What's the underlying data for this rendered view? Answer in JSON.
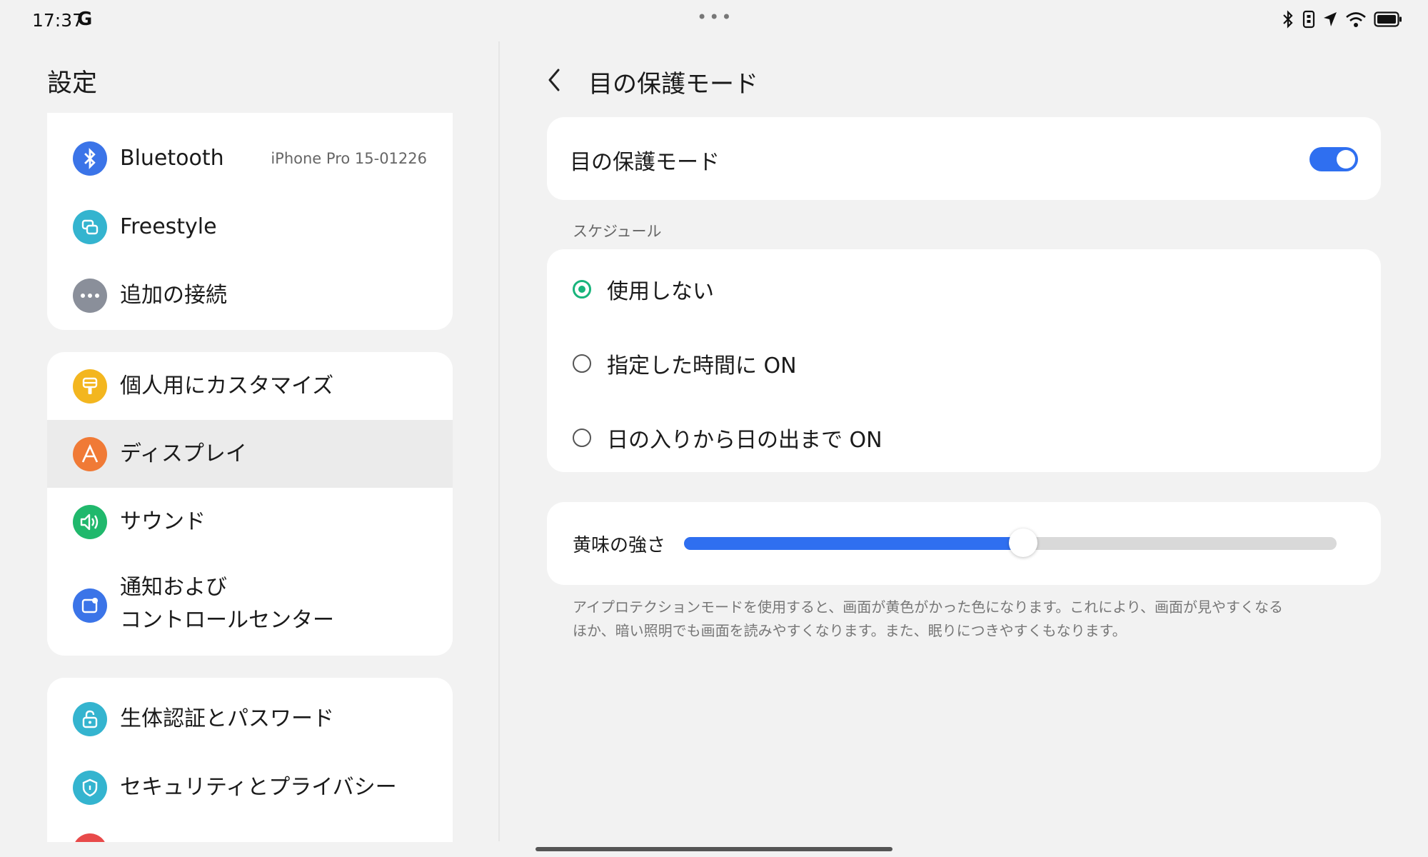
{
  "status_bar": {
    "time": "17:37",
    "g_badge": "G",
    "center_dots": "•••",
    "icons": [
      "bluetooth-icon",
      "vibrate-icon",
      "location-icon",
      "wifi-icon",
      "battery-icon"
    ]
  },
  "sidebar": {
    "title": "設定",
    "groups": [
      {
        "items": [
          {
            "label": "Bluetooth",
            "value": "iPhone Pro 15-01226",
            "icon": "bluetooth-icon",
            "color": "#3b74e8"
          },
          {
            "label": "Freestyle",
            "icon": "freestyle-icon",
            "color": "#34b4cf"
          },
          {
            "label": "追加の接続",
            "icon": "more-icon",
            "color": "#8a8f9a"
          }
        ]
      },
      {
        "items": [
          {
            "label": "個人用にカスタマイズ",
            "icon": "brush-icon",
            "color": "#f3b61f"
          },
          {
            "label": "ディスプレイ",
            "icon": "display-icon",
            "color": "#f07a36",
            "selected": true
          },
          {
            "label": "サウンド",
            "icon": "sound-icon",
            "color": "#20b86c"
          },
          {
            "label": "通知および",
            "label2": "コントロールセンター",
            "icon": "notification-icon",
            "color": "#3b74e8"
          }
        ]
      },
      {
        "items": [
          {
            "label": "生体認証とパスワード",
            "icon": "lock-icon",
            "color": "#34b4cf"
          },
          {
            "label": "セキュリティとプライバシー",
            "icon": "shield-icon",
            "color": "#34b4cf"
          },
          {
            "label": "",
            "icon": "partial-icon",
            "color": "#e84a4a"
          }
        ]
      }
    ]
  },
  "detail": {
    "title": "目の保護モード",
    "toggle": {
      "label": "目の保護モード",
      "on": true
    },
    "schedule": {
      "label": "スケジュール",
      "options": [
        {
          "label": "使用しない",
          "selected": true
        },
        {
          "label": "指定した時間に ON",
          "selected": false
        },
        {
          "label": "日の入りから日の出まで ON",
          "selected": false
        }
      ]
    },
    "slider": {
      "label": "黄味の強さ",
      "value_fraction": 0.52
    },
    "description_line1": "アイプロテクションモードを使用すると、画面が黄色がかった色になります。これにより、画面が見やすくなる",
    "description_line2": "ほか、暗い照明でも画面を読みやすくなります。また、眠りにつきやすくもなります。"
  },
  "colors": {
    "accent": "#2f6ff0",
    "radio_on": "#18b47b",
    "background": "#f2f2f2"
  }
}
